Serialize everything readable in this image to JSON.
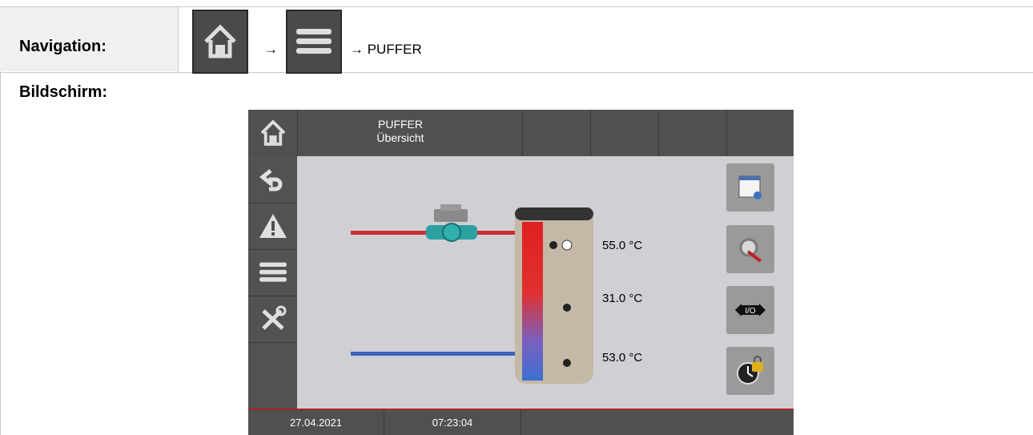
{
  "doc": {
    "navigation_label": "Navigation:",
    "arrow1": "→",
    "arrow2": "→ PUFFER",
    "screen_label": "Bildschirm:"
  },
  "screen": {
    "title_line1": "PUFFER",
    "title_line2": "Übersicht",
    "temperatures": [
      "55.0 °C",
      "31.0 °C",
      "53.0 °C"
    ],
    "date": "27.04.2021",
    "time": "07:23:04"
  },
  "colors": {
    "hot": "#cc3030",
    "cold": "#4060c0",
    "panel": "#505050",
    "bg": "#cfcfd4"
  }
}
